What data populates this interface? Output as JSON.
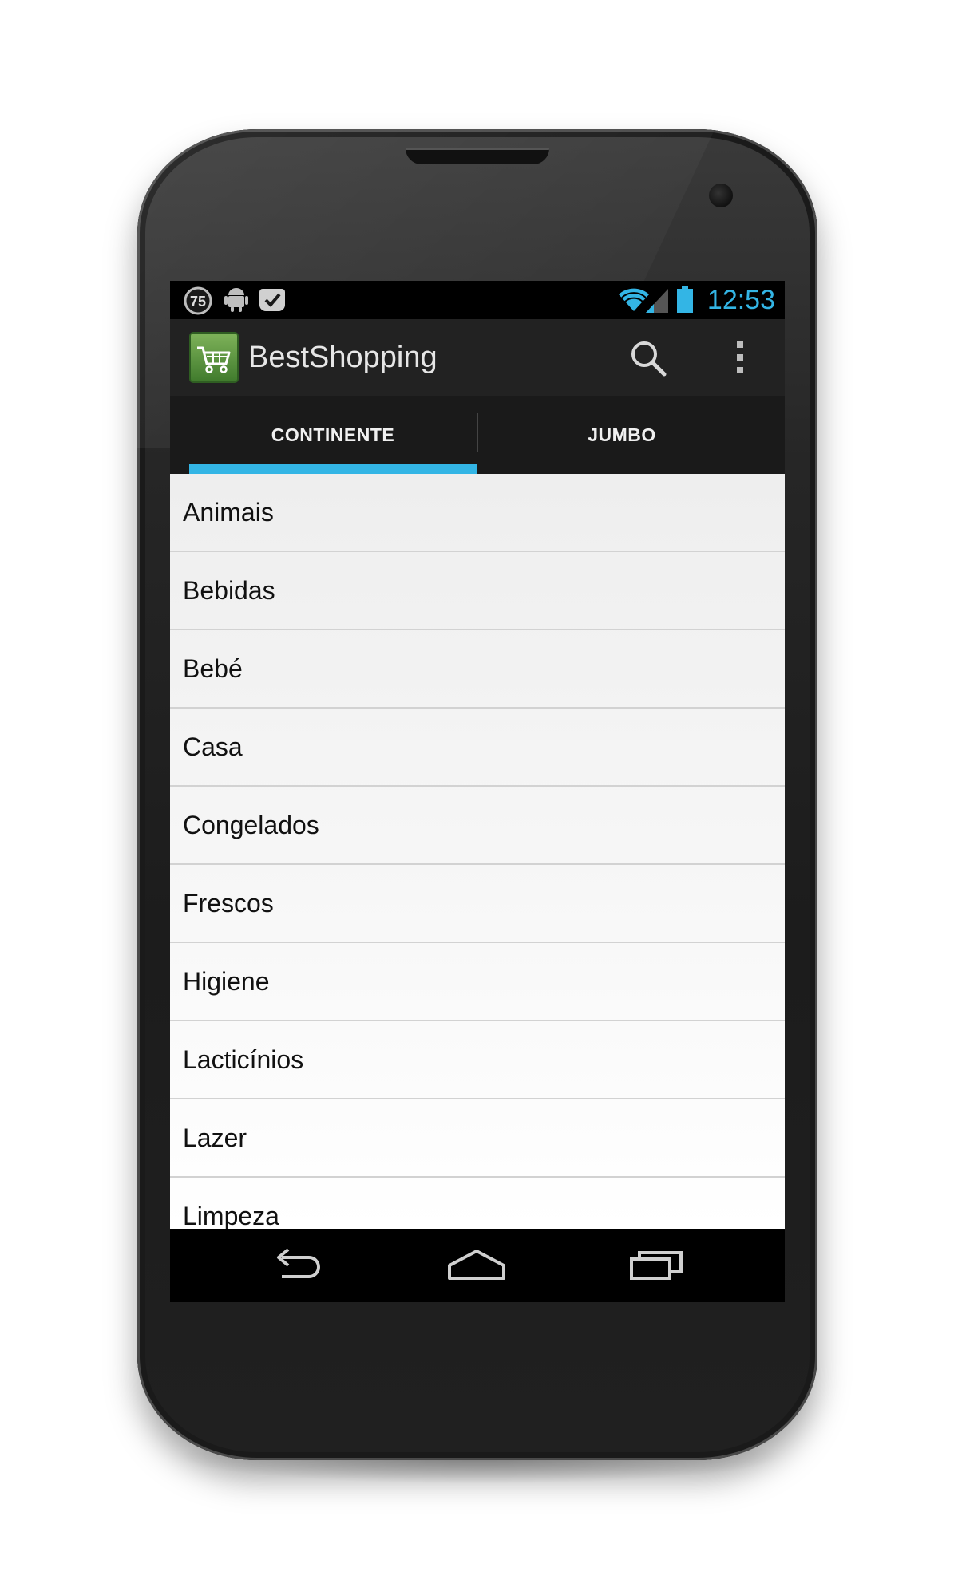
{
  "status_bar": {
    "notification_badge": "75",
    "clock": "12:53",
    "icons": [
      "notification-count-icon",
      "android-icon",
      "checkmark-icon",
      "wifi-icon",
      "signal-icon",
      "battery-icon"
    ]
  },
  "action_bar": {
    "app_title": "BestShopping",
    "app_icon": "shopping-cart-icon",
    "actions": [
      "search-icon",
      "overflow-menu-icon"
    ]
  },
  "tabs": [
    {
      "label": "CONTINENTE",
      "selected": true
    },
    {
      "label": "JUMBO",
      "selected": false
    }
  ],
  "categories": [
    {
      "label": "Animais"
    },
    {
      "label": "Bebidas"
    },
    {
      "label": "Bebé"
    },
    {
      "label": "Casa"
    },
    {
      "label": "Congelados"
    },
    {
      "label": "Frescos"
    },
    {
      "label": "Higiene"
    },
    {
      "label": "Lacticínios"
    },
    {
      "label": "Lazer"
    },
    {
      "label": "Limpeza"
    }
  ],
  "nav_bar": {
    "buttons": [
      "back-icon",
      "home-icon",
      "recent-apps-icon"
    ]
  },
  "colors": {
    "accent": "#33b5e5",
    "action_bar": "#222222",
    "app_icon_green": "#5a8f3c"
  }
}
